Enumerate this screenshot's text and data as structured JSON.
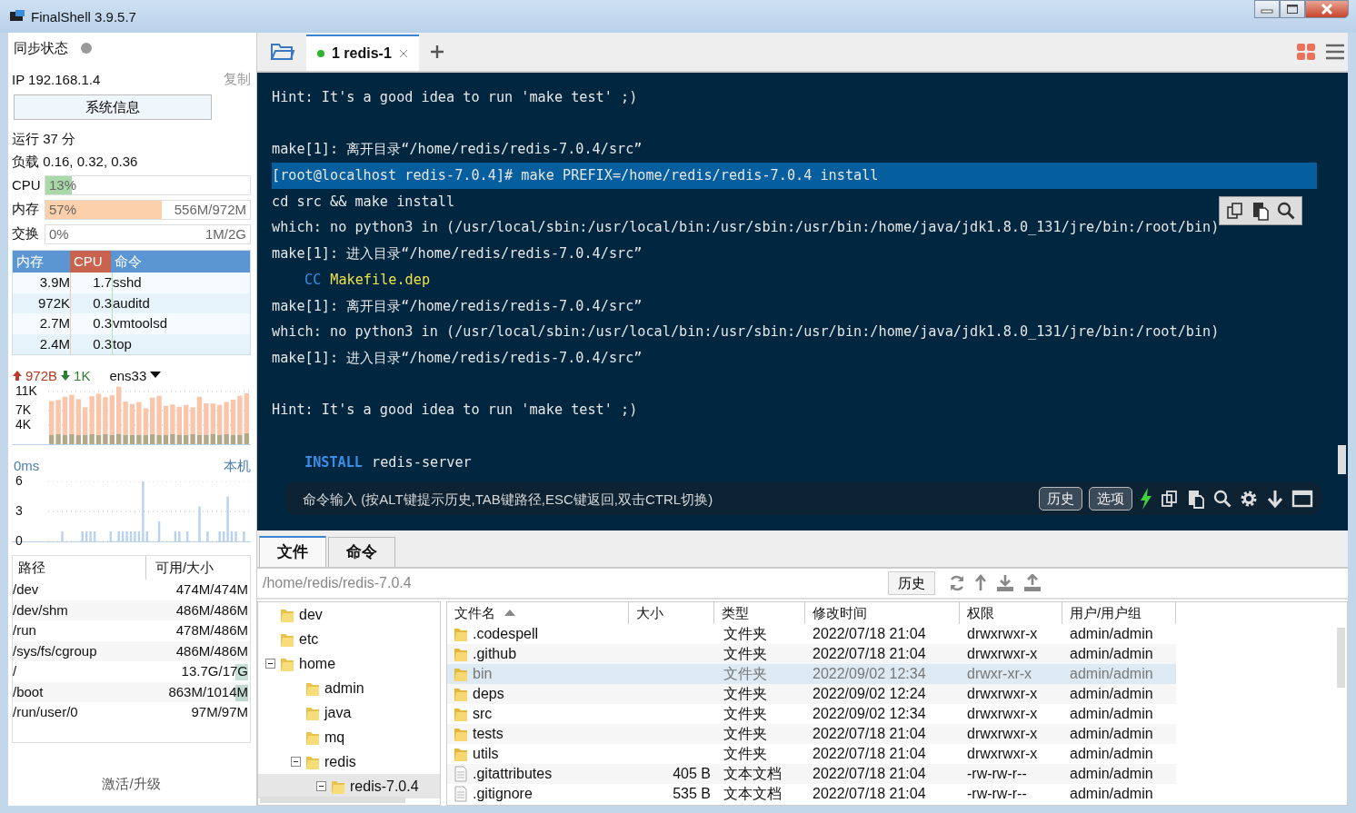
{
  "window": {
    "title": "FinalShell 3.9.5.7"
  },
  "sidebar": {
    "sync_label": "同步状态",
    "ip": "IP 192.168.1.4",
    "copy_link": "复制",
    "sysinfo_button": "系统信息",
    "uptime": "运行 37 分",
    "load": "负载 0.16, 0.32, 0.36",
    "meters": [
      {
        "label": "CPU",
        "percent": "13%",
        "level": 0.13,
        "color": "#a9d9a9"
      },
      {
        "label": "内存",
        "percent": "57%",
        "detail": "556M/972M",
        "level": 0.57,
        "color": "#fcd0aa"
      },
      {
        "label": "交换",
        "percent": "0%",
        "detail": "1M/2G"
      }
    ],
    "process_table": {
      "columns": [
        {
          "label": "内存",
          "selected": false
        },
        {
          "label": "CPU",
          "selected": true
        },
        {
          "label": "命令",
          "selected": false
        }
      ],
      "rows": [
        [
          "3.9M",
          "1.7",
          "sshd"
        ],
        [
          "972K",
          "0.3",
          "auditd"
        ],
        [
          "2.7M",
          "0.3",
          "vmtoolsd"
        ],
        [
          "2.4M",
          "0.3",
          "top"
        ]
      ]
    },
    "network": {
      "upload": "972B",
      "download": "1K",
      "interface": "ens33",
      "chart_data": {
        "type": "bar",
        "stacked": true,
        "grid": true,
        "ylim": [
          0,
          12500
        ],
        "yticks": [
          {
            "value": 11000,
            "label": "11K"
          },
          {
            "value": 7000,
            "label": "7K"
          },
          {
            "value": 4000,
            "label": "4K"
          }
        ],
        "series": [
          {
            "color": "#b3a888",
            "values": [
              2000,
              2100,
              2000,
              2100,
              1900,
              2000,
              2100,
              2000,
              2100,
              2000,
              2200,
              2000,
              1900,
              2000,
              2000,
              2100,
              2000,
              2000,
              2100,
              2000,
              2000,
              2100,
              2000,
              2000,
              2200,
              2000,
              2100,
              2000,
              2000,
              2300
            ]
          },
          {
            "color": "#fac5aa",
            "values": [
              7000,
              7100,
              7900,
              8200,
              7500,
              5700,
              7900,
              8500,
              7700,
              8200,
              9800,
              6900,
              6500,
              6800,
              5500,
              7600,
              8100,
              6000,
              6200,
              5800,
              6200,
              5600,
              7900,
              6500,
              6300,
              6200,
              6700,
              7300,
              8100,
              8300
            ]
          }
        ]
      }
    },
    "latency": {
      "reading": "0ms",
      "host": "本机",
      "chart_data": {
        "type": "bar",
        "grid": true,
        "ylim": [
          0,
          6
        ],
        "yticks": [
          6,
          3,
          0
        ],
        "series": [
          {
            "color": "#b9d2ef",
            "values": [
              0,
              0,
              0,
              1,
              0,
              0,
              0,
              0,
              1,
              1,
              1,
              1,
              0,
              0,
              0,
              1,
              0,
              1,
              1,
              1,
              1,
              1,
              1,
              6,
              1,
              0,
              0,
              2,
              0,
              0,
              0,
              1,
              1,
              0,
              1,
              0,
              0,
              3.5,
              0,
              1,
              0,
              0,
              1,
              1,
              4.5,
              1,
              1,
              0,
              1,
              0
            ]
          }
        ]
      }
    },
    "disks": {
      "columns": [
        "路径",
        "可用/大小"
      ],
      "rows": [
        {
          "path": "/dev",
          "usage": "474M/474M",
          "highlight": false
        },
        {
          "path": "/dev/shm",
          "usage": "486M/486M",
          "highlight": false
        },
        {
          "path": "/run",
          "usage": "478M/486M",
          "highlight": false
        },
        {
          "path": "/sys/fs/cgroup",
          "usage": "486M/486M",
          "highlight": false
        },
        {
          "path": "/",
          "usage": "13.7G/17G",
          "highlight": true
        },
        {
          "path": "/boot",
          "usage": "863M/1014M",
          "highlight": true
        },
        {
          "path": "/run/user/0",
          "usage": "97M/97M",
          "highlight": false
        }
      ]
    },
    "activate_link": "激活/升级"
  },
  "tabs": [
    {
      "label": "1 redis-1",
      "selected": true,
      "connected": true
    }
  ],
  "terminal": {
    "lines": [
      {
        "kind": "text",
        "text": "Hint: It's a good idea to run 'make test' ;)"
      },
      {
        "kind": "blank"
      },
      {
        "kind": "text",
        "text": "make[1]: 离开目录“/home/redis/redis-7.0.4/src”"
      },
      {
        "kind": "highlight",
        "text": "[root@localhost redis-7.0.4]# make PREFIX=/home/redis/redis-7.0.4 install"
      },
      {
        "kind": "text",
        "text": "cd src && make install"
      },
      {
        "kind": "text",
        "text": "which: no python3 in (/usr/local/sbin:/usr/local/bin:/usr/sbin:/usr/bin:/home/java/jdk1.8.0_131/jre/bin:/root/bin)"
      },
      {
        "kind": "text",
        "text": "make[1]: 进入目录“/home/redis/redis-7.0.4/src”"
      },
      {
        "kind": "cc",
        "tag": "CC",
        "text": "Makefile.dep"
      },
      {
        "kind": "text",
        "text": "make[1]: 离开目录“/home/redis/redis-7.0.4/src”"
      },
      {
        "kind": "text",
        "text": "which: no python3 in (/usr/local/sbin:/usr/local/bin:/usr/sbin:/usr/bin:/home/java/jdk1.8.0_131/jre/bin:/root/bin)"
      },
      {
        "kind": "text",
        "text": "make[1]: 进入目录“/home/redis/redis-7.0.4/src”"
      },
      {
        "kind": "blank"
      },
      {
        "kind": "text",
        "text": "Hint: It's a good idea to run 'make test' ;)"
      },
      {
        "kind": "blank"
      },
      {
        "kind": "install",
        "tag": "INSTALL",
        "text": "redis-server"
      }
    ],
    "command_input": {
      "placeholder": "命令输入 (按ALT键提示历史,TAB键路径,ESC键返回,双击CTRL切换)"
    },
    "history_button": "历史",
    "options_button": "选项"
  },
  "bottom_tabs": [
    {
      "label": "文件",
      "selected": true
    },
    {
      "label": "命令",
      "selected": false
    }
  ],
  "file_browser": {
    "path": "/home/redis/redis-7.0.4",
    "history_button": "历史",
    "tree": [
      {
        "name": "dev",
        "selected": false
      },
      {
        "name": "etc",
        "selected": false
      },
      {
        "name": "home",
        "selected": false,
        "expanded": true,
        "children": [
          {
            "name": "admin",
            "selected": false
          },
          {
            "name": "java",
            "selected": false
          },
          {
            "name": "mq",
            "selected": false
          },
          {
            "name": "redis",
            "selected": false,
            "expanded": true,
            "children": [
              {
                "name": "redis-7.0.4",
                "selected": true,
                "expanded": true
              }
            ]
          }
        ]
      }
    ],
    "columns": [
      {
        "label": "文件名",
        "sorted": true
      },
      {
        "label": "大小",
        "sorted": false
      },
      {
        "label": "类型",
        "sorted": false
      },
      {
        "label": "修改时间",
        "sorted": false
      },
      {
        "label": "权限",
        "sorted": false
      },
      {
        "label": "用户/用户组",
        "sorted": false
      }
    ],
    "rows": [
      {
        "kind": "folder",
        "name": ".codespell",
        "type": "文件夹",
        "modified": "2022/07/18 21:04",
        "permissions": "drwxrwxr-x",
        "owner": "admin/admin",
        "selected": false
      },
      {
        "kind": "folder",
        "name": ".github",
        "type": "文件夹",
        "modified": "2022/07/18 21:04",
        "permissions": "drwxrwxr-x",
        "owner": "admin/admin",
        "selected": false
      },
      {
        "kind": "folder",
        "name": "bin",
        "type": "文件夹",
        "modified": "2022/09/02 12:34",
        "permissions": "drwxr-xr-x",
        "owner": "admin/admin",
        "selected": true
      },
      {
        "kind": "folder",
        "name": "deps",
        "type": "文件夹",
        "modified": "2022/09/02 12:24",
        "permissions": "drwxrwxr-x",
        "owner": "admin/admin",
        "selected": false
      },
      {
        "kind": "folder",
        "name": "src",
        "type": "文件夹",
        "modified": "2022/09/02 12:34",
        "permissions": "drwxrwxr-x",
        "owner": "admin/admin",
        "selected": false
      },
      {
        "kind": "folder",
        "name": "tests",
        "type": "文件夹",
        "modified": "2022/07/18 21:04",
        "permissions": "drwxrwxr-x",
        "owner": "admin/admin",
        "selected": false
      },
      {
        "kind": "folder",
        "name": "utils",
        "type": "文件夹",
        "modified": "2022/07/18 21:04",
        "permissions": "drwxrwxr-x",
        "owner": "admin/admin",
        "selected": false
      },
      {
        "kind": "file",
        "name": ".gitattributes",
        "size": "405 B",
        "type": "文本文档",
        "modified": "2022/07/18 21:04",
        "permissions": "-rw-rw-r--",
        "owner": "admin/admin",
        "selected": false
      },
      {
        "kind": "file",
        "name": ".gitignore",
        "size": "535 B",
        "type": "文本文档",
        "modified": "2022/07/18 21:04",
        "permissions": "-rw-rw-r--",
        "owner": "admin/admin",
        "selected": false
      }
    ]
  }
}
